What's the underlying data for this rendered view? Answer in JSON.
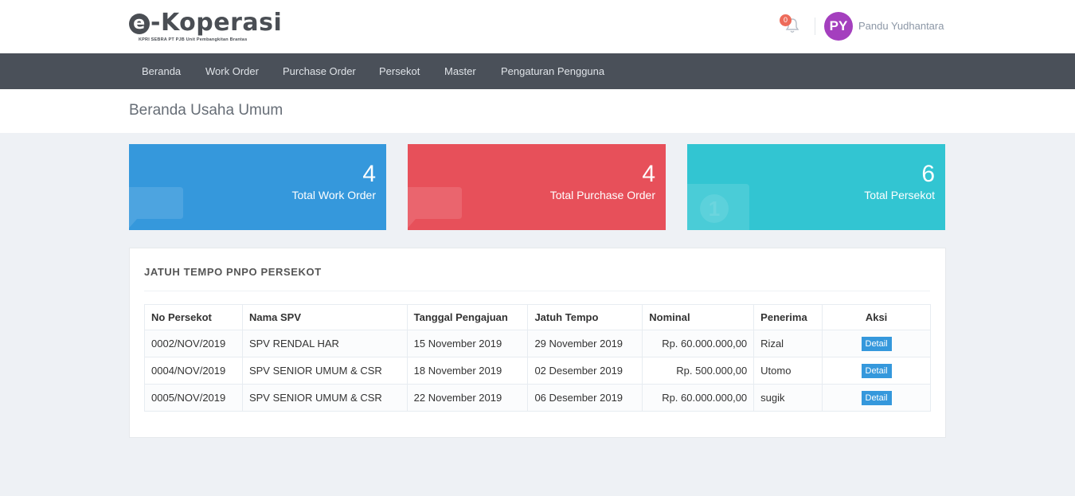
{
  "brand": {
    "logo_text": "e-Koperasi",
    "tagline": "KPRI SEBRA PT PJB Unit Pembangkitan Brantas"
  },
  "header": {
    "notification_count": "0",
    "avatar_initials": "PY",
    "user_name": "Pandu Yudhantara"
  },
  "nav": {
    "items": [
      "Beranda",
      "Work Order",
      "Purchase Order",
      "Persekot",
      "Master",
      "Pengaturan Pengguna"
    ]
  },
  "page": {
    "title": "Beranda Usaha Umum"
  },
  "stats": [
    {
      "value": "4",
      "label": "Total Work Order",
      "color": "#3598dc",
      "icon": "comment-icon"
    },
    {
      "value": "4",
      "label": "Total Purchase Order",
      "color": "#e7505a",
      "icon": "comment-icon"
    },
    {
      "value": "6",
      "label": "Total Persekot",
      "color": "#32c5d2",
      "icon": "money-icon"
    }
  ],
  "panel": {
    "title": "JATUH TEMPO PNPO PERSEKOT",
    "columns": [
      "No Persekot",
      "Nama SPV",
      "Tanggal Pengajuan",
      "Jatuh Tempo",
      "Nominal",
      "Penerima",
      "Aksi"
    ],
    "rows": [
      {
        "no": "0002/NOV/2019",
        "spv": "SPV RENDAL HAR",
        "tanggal": "15 November 2019",
        "jatuh_tempo": "29 November 2019",
        "nominal": "Rp. 60.000.000,00",
        "penerima": "Rizal",
        "aksi": "Detail"
      },
      {
        "no": "0004/NOV/2019",
        "spv": "SPV SENIOR UMUM & CSR",
        "tanggal": "18 November 2019",
        "jatuh_tempo": "02 Desember 2019",
        "nominal": "Rp. 500.000,00",
        "penerima": "Utomo",
        "aksi": "Detail"
      },
      {
        "no": "0005/NOV/2019",
        "spv": "SPV SENIOR UMUM & CSR",
        "tanggal": "22 November 2019",
        "jatuh_tempo": "06 Desember 2019",
        "nominal": "Rp. 60.000.000,00",
        "penerima": "sugik",
        "aksi": "Detail"
      }
    ]
  },
  "colors": {
    "navbar": "#4a5059",
    "accent": "#3598dc",
    "danger": "#e7505a",
    "info": "#32c5d2",
    "avatar": "#a43fbe",
    "badge": "#ed6b5a"
  }
}
